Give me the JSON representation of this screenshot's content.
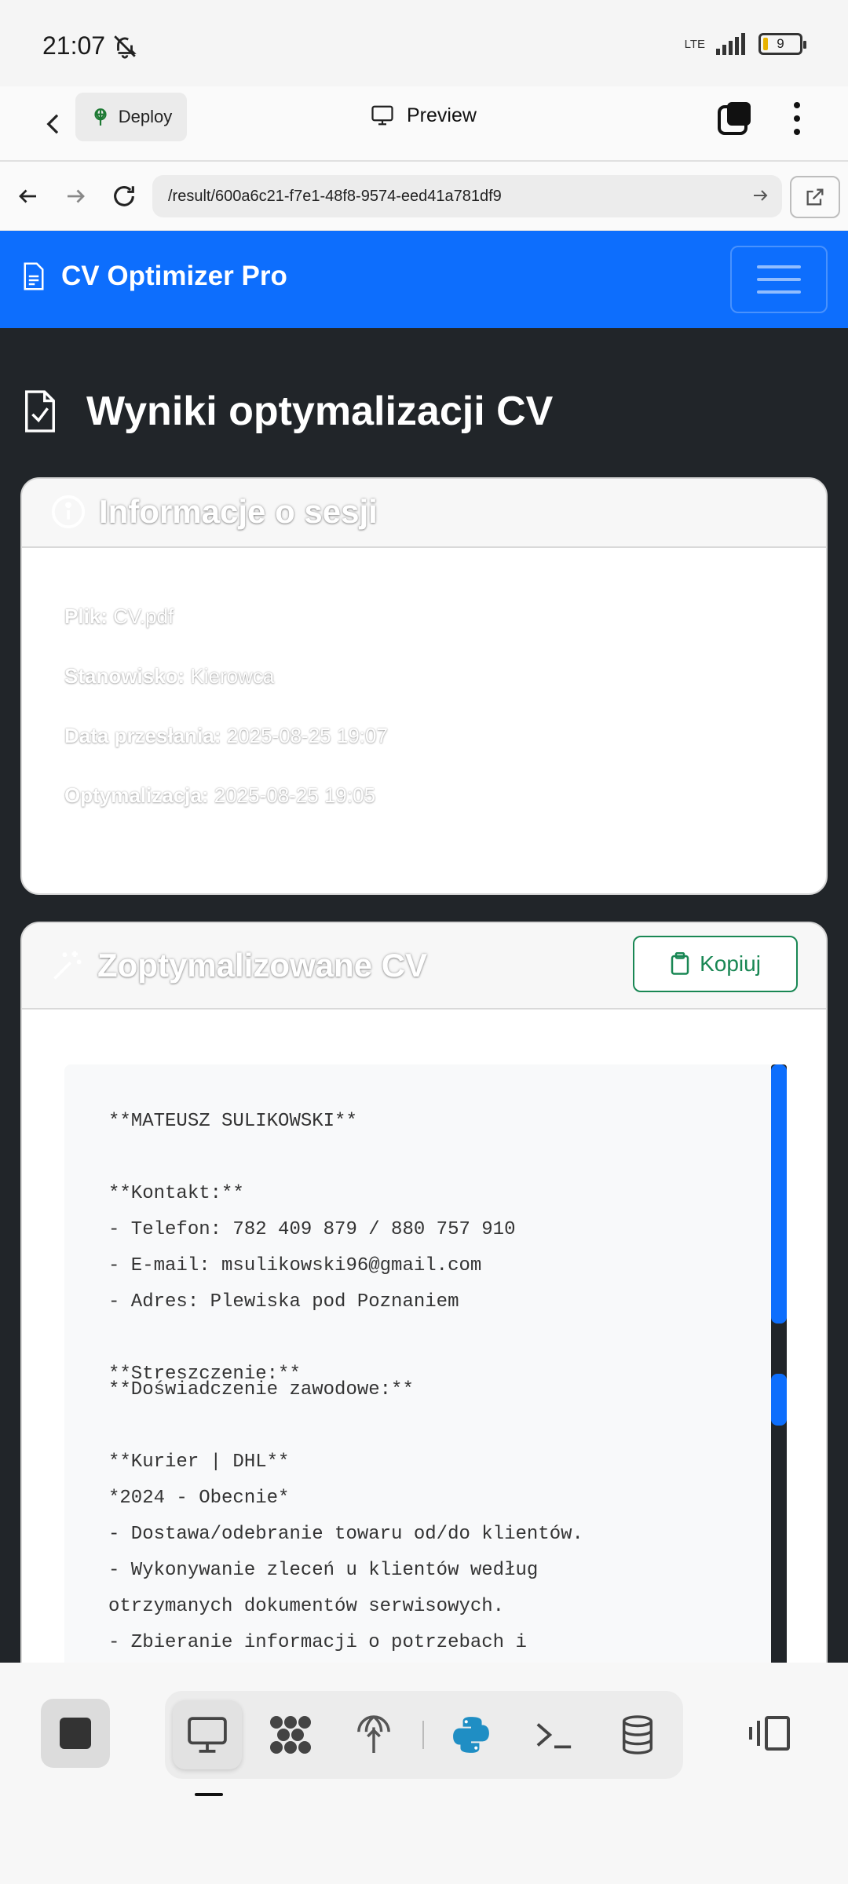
{
  "status": {
    "time": "21:07",
    "network": "LTE",
    "battery": "9"
  },
  "appbar": {
    "deploy_label": "Deploy",
    "preview_label": "Preview"
  },
  "browser": {
    "url": "/result/600a6c21-f7e1-48f8-9574-eed41a781df9"
  },
  "navbar": {
    "brand": "CV Optimizer Pro"
  },
  "page": {
    "title": "Wyniki optymalizacji CV"
  },
  "session_card": {
    "title": "Informacje o sesji",
    "rows": [
      {
        "label": "Plik:",
        "value": "CV.pdf"
      },
      {
        "label": "Stanowisko:",
        "value": "Kierowca"
      },
      {
        "label": "Data przesłania:",
        "value": "2025-08-25 19:07"
      },
      {
        "label": "Optymalizacja:",
        "value": "2025-08-25 19:05"
      }
    ]
  },
  "cv_card": {
    "title": "Zoptymalizowane CV",
    "copy_label": "Kopiuj",
    "lines_top": [
      "**MATEUSZ SULIKOWSKI**",
      "",
      "**Kontakt:**",
      "- Telefon: 782 409 879 / 880 757 910",
      "- E-mail: msulikowski96@gmail.com",
      "- Adres: Plewiska pod Poznaniem",
      "",
      "**Streszczenie:**"
    ],
    "lines_bottom": [
      "**Doświadczenie zawodowe:**",
      "",
      "**Kurier | DHL**",
      "*2024 - Obecnie*",
      "- Dostawa/odebranie towaru od/do klientów.",
      "- Wykonywanie zleceń u klientów według",
      "otrzymanych dokumentów serwisowych.",
      "- Zbieranie informacji o potrzebach i"
    ]
  },
  "colors": {
    "primary": "#0d6efd",
    "success": "#198754",
    "dark_bg": "#212529"
  }
}
